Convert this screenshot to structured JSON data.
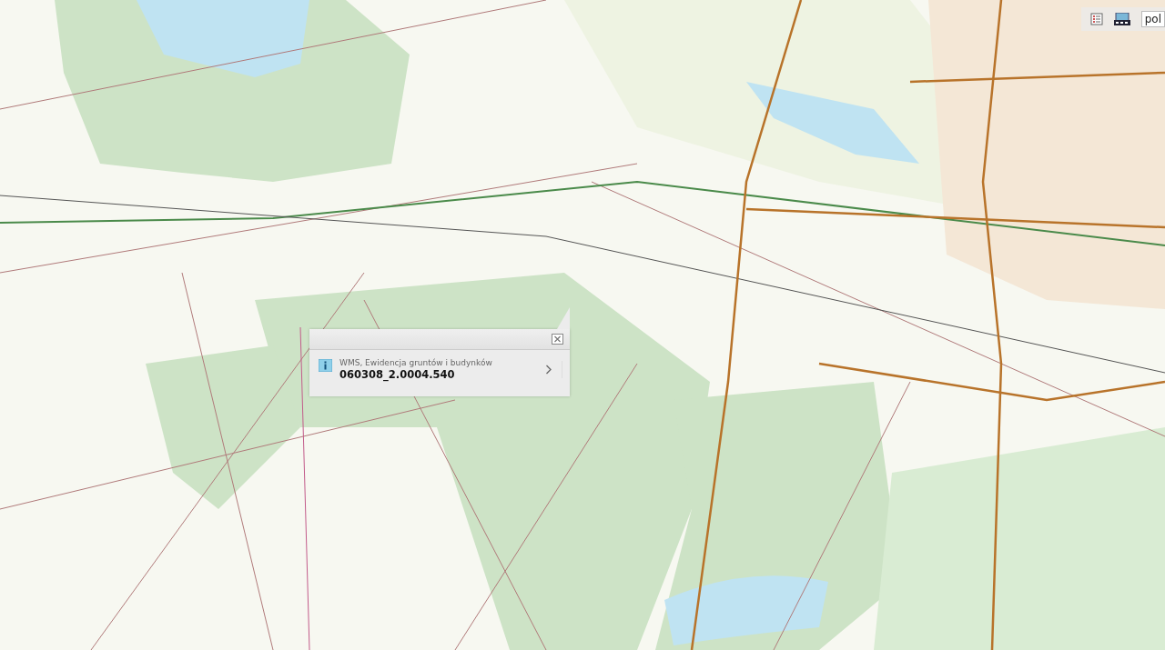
{
  "toolbar": {
    "language": "pol"
  },
  "popup": {
    "layer": "WMS, Ewidencja gruntów i budynków",
    "value": "060308_2.0004.540"
  }
}
